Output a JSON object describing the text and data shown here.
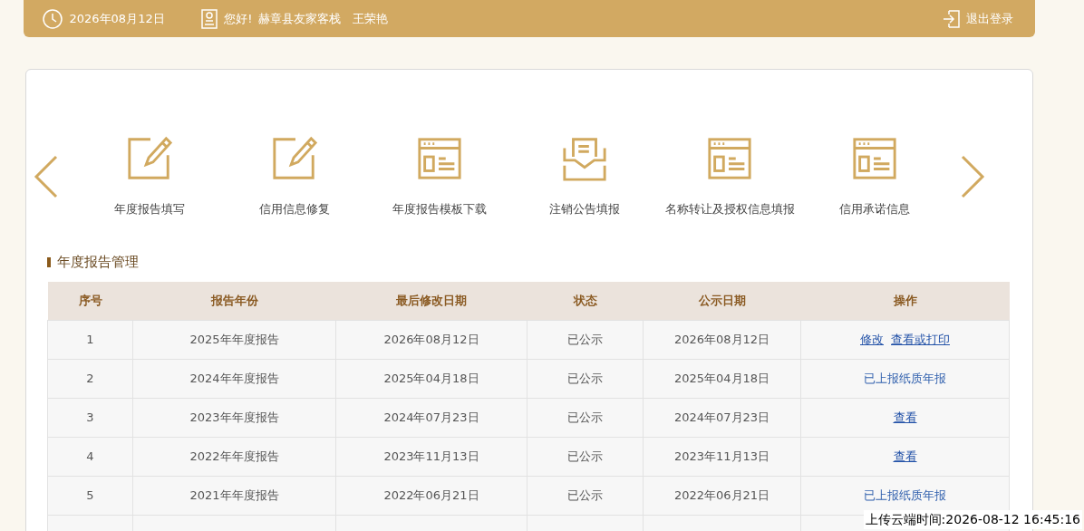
{
  "header": {
    "date": "2026年08月12日",
    "greeting": "您好!",
    "company": "赫章县友家客栈",
    "user": "王荣艳",
    "logout": "退出登录"
  },
  "shortcuts": [
    {
      "label": "年度报告填写",
      "kind": "pencil"
    },
    {
      "label": "信用信息修复",
      "kind": "pencil"
    },
    {
      "label": "年度报告模板下载",
      "kind": "window"
    },
    {
      "label": "注销公告填报",
      "kind": "tray"
    },
    {
      "label": "名称转让及授权信息填报",
      "kind": "window"
    },
    {
      "label": "信用承诺信息",
      "kind": "window"
    }
  ],
  "section_title": "年度报告管理",
  "table": {
    "columns": [
      "序号",
      "报告年份",
      "最后修改日期",
      "状态",
      "公示日期",
      "操作"
    ],
    "rows": [
      {
        "cells": [
          "1",
          "2025年年度报告",
          "2026年08月12日",
          "已公示",
          "2026年08月12日"
        ],
        "actions": [
          {
            "label": "修改",
            "kind": "link"
          },
          {
            "label": "查看或打印",
            "kind": "link"
          }
        ]
      },
      {
        "cells": [
          "2",
          "2024年年度报告",
          "2025年04月18日",
          "已公示",
          "2025年04月18日"
        ],
        "actions": [
          {
            "label": "已上报纸质年报",
            "kind": "text"
          }
        ]
      },
      {
        "cells": [
          "3",
          "2023年年度报告",
          "2024年07月23日",
          "已公示",
          "2024年07月23日"
        ],
        "actions": [
          {
            "label": "查看",
            "kind": "link"
          }
        ]
      },
      {
        "cells": [
          "4",
          "2022年年度报告",
          "2023年11月13日",
          "已公示",
          "2023年11月13日"
        ],
        "actions": [
          {
            "label": "查看",
            "kind": "link"
          }
        ]
      },
      {
        "cells": [
          "5",
          "2021年年度报告",
          "2022年06月21日",
          "已公示",
          "2022年06月21日"
        ],
        "actions": [
          {
            "label": "已上报纸质年报",
            "kind": "text"
          }
        ]
      }
    ]
  },
  "capture_stamp": "上传云端时间:2026-08-12 16:45:16"
}
